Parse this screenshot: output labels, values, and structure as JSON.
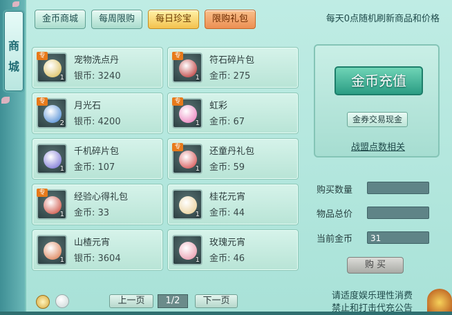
{
  "side_tab": {
    "label_1": "商",
    "label_2": "城"
  },
  "tabs": [
    {
      "label": "金币商城"
    },
    {
      "label": "每周限购"
    },
    {
      "label": "每日珍宝"
    },
    {
      "label": "限购礼包"
    }
  ],
  "notice": "每天0点随机刷新商品和价格",
  "items": [
    {
      "name": "宠物洗点丹",
      "price": "银币: 3240",
      "qty": "1",
      "badge": "专",
      "art_color": "#d7b84a"
    },
    {
      "name": "符石碎片包",
      "price": "金币: 275",
      "qty": "1",
      "badge": "专",
      "art_color": "#b3201f"
    },
    {
      "name": "月光石",
      "price": "银币: 4200",
      "qty": "2",
      "badge": "专",
      "art_color": "#3a7fd0"
    },
    {
      "name": "虹彩",
      "price": "金币: 67",
      "qty": "1",
      "badge": "专",
      "art_color": "#e86fb4"
    },
    {
      "name": "千机碎片包",
      "price": "金币: 107",
      "qty": "1",
      "badge": "",
      "art_color": "#6a63d0"
    },
    {
      "name": "还童丹礼包",
      "price": "金币: 59",
      "qty": "1",
      "badge": "专",
      "art_color": "#d03a3a"
    },
    {
      "name": "经验心得礼包",
      "price": "金币: 33",
      "qty": "1",
      "badge": "专",
      "art_color": "#c73a2a"
    },
    {
      "name": "桂花元宵",
      "price": "金币: 44",
      "qty": "1",
      "badge": "",
      "art_color": "#e6c98a"
    },
    {
      "name": "山楂元宵",
      "price": "银币: 3604",
      "qty": "1",
      "badge": "",
      "art_color": "#d9703f"
    },
    {
      "name": "玫瑰元宵",
      "price": "金币: 46",
      "qty": "1",
      "badge": "",
      "art_color": "#e68aa0"
    }
  ],
  "right": {
    "recharge_label": "金币充值",
    "exchange_label": "金券交易现金",
    "alliance_label": "战盟点数相关"
  },
  "purchase": {
    "qty_label": "购买数量",
    "qty_value": "",
    "total_label": "物品总价",
    "total_value": "",
    "gold_label": "当前金币",
    "gold_value": "31",
    "buy_label": "购 买"
  },
  "pager": {
    "prev_label": "上一页",
    "page": "1/2",
    "next_label": "下一页"
  },
  "footer": {
    "line1": "请适度娱乐理性消费",
    "line2": "禁止和打击代充公告"
  }
}
